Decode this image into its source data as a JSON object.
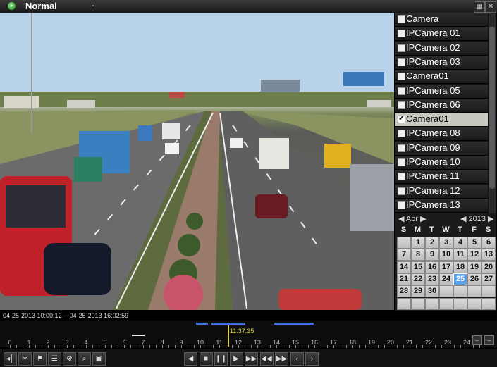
{
  "header": {
    "mode": "Normal",
    "icons": {
      "status": "play-circle-icon",
      "dropdown": "caret-down-icon",
      "fullscreen": "fullscreen-icon",
      "close": "close-icon"
    }
  },
  "camera_panel": {
    "items": [
      {
        "label": "Camera",
        "checked": false
      },
      {
        "label": "IPCamera 01",
        "checked": false
      },
      {
        "label": "IPCamera 02",
        "checked": false
      },
      {
        "label": "IPCamera 03",
        "checked": false
      },
      {
        "label": "Camera01",
        "checked": false
      },
      {
        "label": "IPCamera 05",
        "checked": false
      },
      {
        "label": "IPCamera 06",
        "checked": false
      },
      {
        "label": "Camera01",
        "checked": true
      },
      {
        "label": "IPCamera 08",
        "checked": false
      },
      {
        "label": "IPCamera 09",
        "checked": false
      },
      {
        "label": "IPCamera 10",
        "checked": false
      },
      {
        "label": "IPCamera 11",
        "checked": false
      },
      {
        "label": "IPCamera 12",
        "checked": false
      },
      {
        "label": "IPCamera 13",
        "checked": false
      }
    ]
  },
  "calendar": {
    "month": "Apr",
    "year": "2013",
    "weekdays": [
      "S",
      "M",
      "T",
      "W",
      "T",
      "F",
      "S"
    ],
    "start_offset": 1,
    "days_in_month": 30,
    "today": 25
  },
  "timeline": {
    "range": "04-25-2013 10:00:12 -- 04-25-2013 16:02:59",
    "cursor_time": "11:37:35",
    "ticks": [
      "0",
      "1",
      "2",
      "3",
      "4",
      "5",
      "6",
      "7",
      "8",
      "9",
      "10",
      "11",
      "12",
      "13",
      "14",
      "15",
      "16",
      "17",
      "18",
      "19",
      "20",
      "21",
      "22",
      "23",
      "24"
    ]
  },
  "toolbar": {
    "left_tools": [
      "volume-icon",
      "clip-icon",
      "tag-icon",
      "custom-tag-icon",
      "settings-icon",
      "zoom-icon",
      "picture-icon"
    ],
    "playback": [
      "reverse-icon",
      "stop-icon",
      "pause-icon",
      "slow-icon",
      "fast-icon",
      "rewind-30s-icon",
      "forward-30s-icon",
      "prev-day-icon",
      "next-day-icon"
    ]
  },
  "colors": {
    "recording_bar": "#3d6fe0",
    "cursor": "#e6d23a",
    "selected_day": "#5aa0e8"
  }
}
